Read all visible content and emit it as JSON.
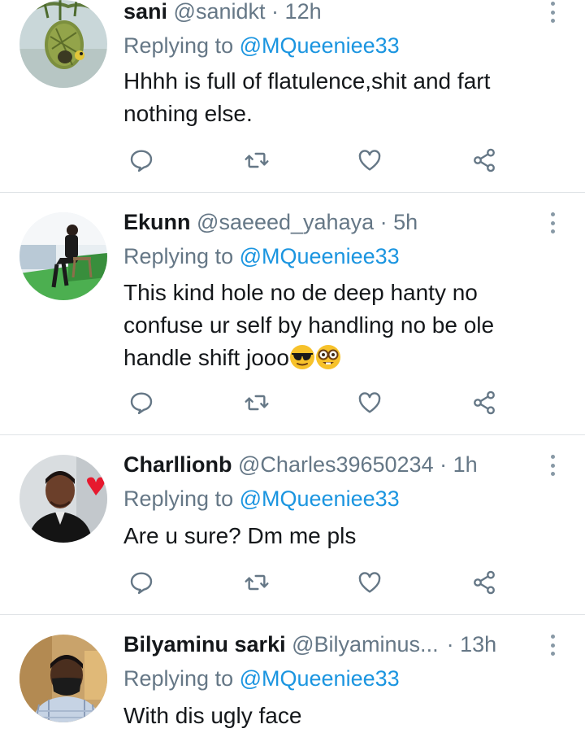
{
  "reply_prefix": "Replying to",
  "tweets": [
    {
      "name": "sani",
      "handle": "@sanidkt",
      "dot": "·",
      "time": "12h",
      "mention": "@MQueeniee33",
      "text": "Hhhh is full of flatulence,shit and fart nothing else.",
      "avatar": "bird-nest-avatar"
    },
    {
      "name": "Ekunn",
      "handle": "@saeeed_yahaya",
      "dot": "·",
      "time": "5h",
      "mention": "@MQueeniee33",
      "text": "This kind hole no de deep hanty no confuse ur self by handling no be ole handle shift jooo",
      "emojis": [
        "sunglasses-face",
        "nerd-face"
      ],
      "avatar": "man-seated-avatar"
    },
    {
      "name": "Charllionb",
      "handle": "@Charles39650234",
      "dot": "·",
      "time": "1h",
      "mention": "@MQueeniee33",
      "text": "Are u sure? Dm me pls",
      "avatar": "man-heart-avatar"
    },
    {
      "name": "Bilyaminu sarki",
      "handle": "@Bilyaminus...",
      "dot": "·",
      "time": "13h",
      "mention": "@MQueeniee33",
      "text": "With dis ugly face",
      "avatar": "man-mask-avatar"
    }
  ],
  "colors": {
    "name": "#14171a",
    "secondary": "#657786",
    "mention": "#1b95e0",
    "icon": "#657786",
    "divider": "#dfe3e6"
  }
}
